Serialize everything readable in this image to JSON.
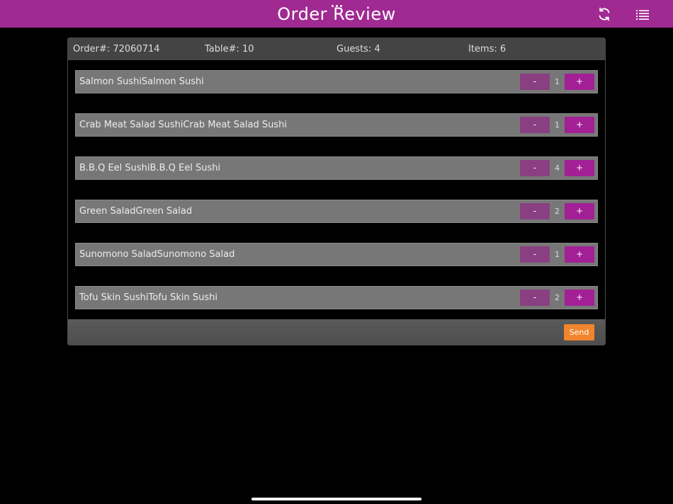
{
  "header": {
    "title": "Order Review",
    "refresh_icon": "refresh-icon",
    "menu_icon": "list-menu-icon",
    "color": "#a02a92"
  },
  "order_info": {
    "order": "Order#: 72060714",
    "table": "Table#: 10",
    "guests": "Guests: 4",
    "items": "Items: 6"
  },
  "items": [
    {
      "name": "Salmon SushiSalmon Sushi",
      "qty": "1",
      "minus": "-",
      "plus": "+"
    },
    {
      "name": "Crab Meat Salad SushiCrab Meat Salad Sushi",
      "qty": "1",
      "minus": "-",
      "plus": "+"
    },
    {
      "name": "B.B.Q Eel SushiB.B.Q Eel Sushi",
      "qty": "4",
      "minus": "-",
      "plus": "+"
    },
    {
      "name": "Green SaladGreen Salad",
      "qty": "2",
      "minus": "-",
      "plus": "+"
    },
    {
      "name": "Sunomono SaladSunomono Salad",
      "qty": "1",
      "minus": "-",
      "plus": "+"
    },
    {
      "name": "Tofu Skin SushiTofu Skin Sushi",
      "qty": "2",
      "minus": "-",
      "plus": "+"
    }
  ],
  "footer": {
    "send_label": "Send",
    "send_color": "#f0852d"
  }
}
